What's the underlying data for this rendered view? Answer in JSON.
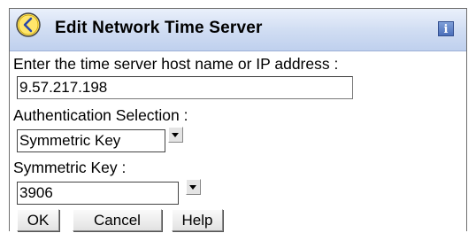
{
  "dialog": {
    "title": "Edit Network Time Server",
    "clock_icon": "clock-icon",
    "info_icon": "info-icon",
    "info_glyph": "i"
  },
  "form": {
    "host_label": "Enter the time server host name or IP address :",
    "host_value": "9.57.217.198",
    "auth_label": "Authentication Selection :",
    "auth_selected": "Symmetric Key",
    "key_label": "Symmetric Key :",
    "key_selected": "3906"
  },
  "buttons": {
    "ok": "OK",
    "cancel": "Cancel",
    "help": "Help"
  },
  "colors": {
    "titlebar": "#cfdcf2",
    "info_button": "#4b6fba"
  }
}
